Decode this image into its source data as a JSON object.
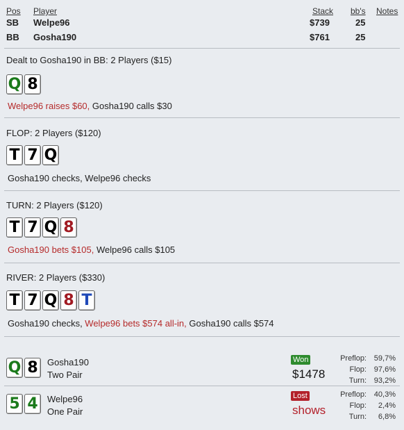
{
  "header": {
    "pos": "Pos",
    "player": "Player",
    "stack": "Stack",
    "bbs": "bb's",
    "notes": "Notes"
  },
  "players": [
    {
      "pos": "SB",
      "name": "Welpe96",
      "stack": "$739",
      "bbs": "25"
    },
    {
      "pos": "BB",
      "name": "Gosha190",
      "stack": "$761",
      "bbs": "25"
    }
  ],
  "preflop": {
    "title": "Dealt to Gosha190 in BB: 2 Players ($15)",
    "cards": [
      {
        "rank": "Q",
        "suit": "clubs"
      },
      {
        "rank": "8",
        "suit": "spades"
      }
    ],
    "action_red": "Welpe96 raises $60,",
    "action_rest": " Gosha190 calls $30"
  },
  "flop": {
    "title": "FLOP: 2 Players ($120)",
    "cards": [
      {
        "rank": "T",
        "suit": "spades"
      },
      {
        "rank": "7",
        "suit": "spades"
      },
      {
        "rank": "Q",
        "suit": "spades"
      }
    ],
    "action": "Gosha190 checks, Welpe96 checks"
  },
  "turn": {
    "title": "TURN: 2 Players ($120)",
    "cards": [
      {
        "rank": "T",
        "suit": "spades"
      },
      {
        "rank": "7",
        "suit": "spades"
      },
      {
        "rank": "Q",
        "suit": "spades"
      },
      {
        "rank": "8",
        "suit": "hearts"
      }
    ],
    "action_red": "Gosha190 bets $105,",
    "action_rest": " Welpe96 calls $105"
  },
  "river": {
    "title": "RIVER: 2 Players ($330)",
    "cards": [
      {
        "rank": "T",
        "suit": "spades"
      },
      {
        "rank": "7",
        "suit": "spades"
      },
      {
        "rank": "Q",
        "suit": "spades"
      },
      {
        "rank": "8",
        "suit": "hearts"
      },
      {
        "rank": "T",
        "suit": "diamonds"
      }
    ],
    "action_a": "Gosha190 checks, ",
    "action_red": "Welpe96 bets $574 all-in,",
    "action_rest": " Gosha190 calls $574"
  },
  "results": [
    {
      "cards": [
        {
          "rank": "Q",
          "suit": "clubs"
        },
        {
          "rank": "8",
          "suit": "spades"
        }
      ],
      "name": "Gosha190",
      "hand": "Two Pair",
      "badge": "Won",
      "amount": "$1478",
      "stats": [
        {
          "label": "Preflop:",
          "value": "59,7%"
        },
        {
          "label": "Flop:",
          "value": "97,6%"
        },
        {
          "label": "Turn:",
          "value": "93,2%"
        }
      ]
    },
    {
      "cards": [
        {
          "rank": "5",
          "suit": "clubs"
        },
        {
          "rank": "4",
          "suit": "clubs"
        }
      ],
      "name": "Welpe96",
      "hand": "One Pair",
      "badge": "Lost",
      "amount": "shows",
      "stats": [
        {
          "label": "Preflop:",
          "value": "40,3%"
        },
        {
          "label": "Flop:",
          "value": "2,4%"
        },
        {
          "label": "Turn:",
          "value": "6,8%"
        }
      ]
    }
  ],
  "suit_colors": {
    "spades": "#000000",
    "clubs": "#1b7a1b",
    "hearts": "#a11a22",
    "diamonds": "#1f49b8"
  },
  "colors": {
    "won": "#2e8b2e",
    "lost": "#b3202a",
    "action_red": "#b52a2a"
  }
}
